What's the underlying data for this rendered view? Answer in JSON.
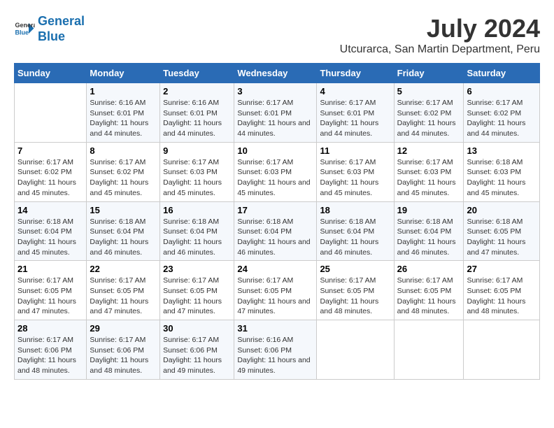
{
  "logo": {
    "line1": "General",
    "line2": "Blue"
  },
  "title": "July 2024",
  "subtitle": "Utcurarca, San Martin Department, Peru",
  "weekdays": [
    "Sunday",
    "Monday",
    "Tuesday",
    "Wednesday",
    "Thursday",
    "Friday",
    "Saturday"
  ],
  "weeks": [
    [
      {
        "day": "",
        "info": ""
      },
      {
        "day": "1",
        "info": "Sunrise: 6:16 AM\nSunset: 6:01 PM\nDaylight: 11 hours and 44 minutes."
      },
      {
        "day": "2",
        "info": "Sunrise: 6:16 AM\nSunset: 6:01 PM\nDaylight: 11 hours and 44 minutes."
      },
      {
        "day": "3",
        "info": "Sunrise: 6:17 AM\nSunset: 6:01 PM\nDaylight: 11 hours and 44 minutes."
      },
      {
        "day": "4",
        "info": "Sunrise: 6:17 AM\nSunset: 6:01 PM\nDaylight: 11 hours and 44 minutes."
      },
      {
        "day": "5",
        "info": "Sunrise: 6:17 AM\nSunset: 6:02 PM\nDaylight: 11 hours and 44 minutes."
      },
      {
        "day": "6",
        "info": "Sunrise: 6:17 AM\nSunset: 6:02 PM\nDaylight: 11 hours and 44 minutes."
      }
    ],
    [
      {
        "day": "7",
        "info": "Sunrise: 6:17 AM\nSunset: 6:02 PM\nDaylight: 11 hours and 45 minutes."
      },
      {
        "day": "8",
        "info": "Sunrise: 6:17 AM\nSunset: 6:02 PM\nDaylight: 11 hours and 45 minutes."
      },
      {
        "day": "9",
        "info": "Sunrise: 6:17 AM\nSunset: 6:03 PM\nDaylight: 11 hours and 45 minutes."
      },
      {
        "day": "10",
        "info": "Sunrise: 6:17 AM\nSunset: 6:03 PM\nDaylight: 11 hours and 45 minutes."
      },
      {
        "day": "11",
        "info": "Sunrise: 6:17 AM\nSunset: 6:03 PM\nDaylight: 11 hours and 45 minutes."
      },
      {
        "day": "12",
        "info": "Sunrise: 6:17 AM\nSunset: 6:03 PM\nDaylight: 11 hours and 45 minutes."
      },
      {
        "day": "13",
        "info": "Sunrise: 6:18 AM\nSunset: 6:03 PM\nDaylight: 11 hours and 45 minutes."
      }
    ],
    [
      {
        "day": "14",
        "info": "Sunrise: 6:18 AM\nSunset: 6:04 PM\nDaylight: 11 hours and 45 minutes."
      },
      {
        "day": "15",
        "info": "Sunrise: 6:18 AM\nSunset: 6:04 PM\nDaylight: 11 hours and 46 minutes."
      },
      {
        "day": "16",
        "info": "Sunrise: 6:18 AM\nSunset: 6:04 PM\nDaylight: 11 hours and 46 minutes."
      },
      {
        "day": "17",
        "info": "Sunrise: 6:18 AM\nSunset: 6:04 PM\nDaylight: 11 hours and 46 minutes."
      },
      {
        "day": "18",
        "info": "Sunrise: 6:18 AM\nSunset: 6:04 PM\nDaylight: 11 hours and 46 minutes."
      },
      {
        "day": "19",
        "info": "Sunrise: 6:18 AM\nSunset: 6:04 PM\nDaylight: 11 hours and 46 minutes."
      },
      {
        "day": "20",
        "info": "Sunrise: 6:18 AM\nSunset: 6:05 PM\nDaylight: 11 hours and 47 minutes."
      }
    ],
    [
      {
        "day": "21",
        "info": "Sunrise: 6:17 AM\nSunset: 6:05 PM\nDaylight: 11 hours and 47 minutes."
      },
      {
        "day": "22",
        "info": "Sunrise: 6:17 AM\nSunset: 6:05 PM\nDaylight: 11 hours and 47 minutes."
      },
      {
        "day": "23",
        "info": "Sunrise: 6:17 AM\nSunset: 6:05 PM\nDaylight: 11 hours and 47 minutes."
      },
      {
        "day": "24",
        "info": "Sunrise: 6:17 AM\nSunset: 6:05 PM\nDaylight: 11 hours and 47 minutes."
      },
      {
        "day": "25",
        "info": "Sunrise: 6:17 AM\nSunset: 6:05 PM\nDaylight: 11 hours and 48 minutes."
      },
      {
        "day": "26",
        "info": "Sunrise: 6:17 AM\nSunset: 6:05 PM\nDaylight: 11 hours and 48 minutes."
      },
      {
        "day": "27",
        "info": "Sunrise: 6:17 AM\nSunset: 6:05 PM\nDaylight: 11 hours and 48 minutes."
      }
    ],
    [
      {
        "day": "28",
        "info": "Sunrise: 6:17 AM\nSunset: 6:06 PM\nDaylight: 11 hours and 48 minutes."
      },
      {
        "day": "29",
        "info": "Sunrise: 6:17 AM\nSunset: 6:06 PM\nDaylight: 11 hours and 48 minutes."
      },
      {
        "day": "30",
        "info": "Sunrise: 6:17 AM\nSunset: 6:06 PM\nDaylight: 11 hours and 49 minutes."
      },
      {
        "day": "31",
        "info": "Sunrise: 6:16 AM\nSunset: 6:06 PM\nDaylight: 11 hours and 49 minutes."
      },
      {
        "day": "",
        "info": ""
      },
      {
        "day": "",
        "info": ""
      },
      {
        "day": "",
        "info": ""
      }
    ]
  ]
}
